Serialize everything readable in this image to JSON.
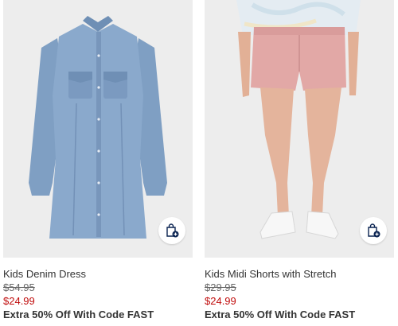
{
  "products": [
    {
      "name": "Kids Denim Dress",
      "original_price": "$54.95",
      "sale_price": "$24.99",
      "promo": "Extra 50% Off With Code FAST",
      "add_icon": "shopping-bag-plus-icon"
    },
    {
      "name": "Kids Midi Shorts with Stretch",
      "original_price": "$29.95",
      "sale_price": "$24.99",
      "promo": "Extra 50% Off With Code FAST",
      "add_icon": "shopping-bag-plus-icon"
    }
  ],
  "colors": {
    "sale": "#c00d0d",
    "image_bg": "#ededed",
    "icon_navy": "#0a2351"
  }
}
